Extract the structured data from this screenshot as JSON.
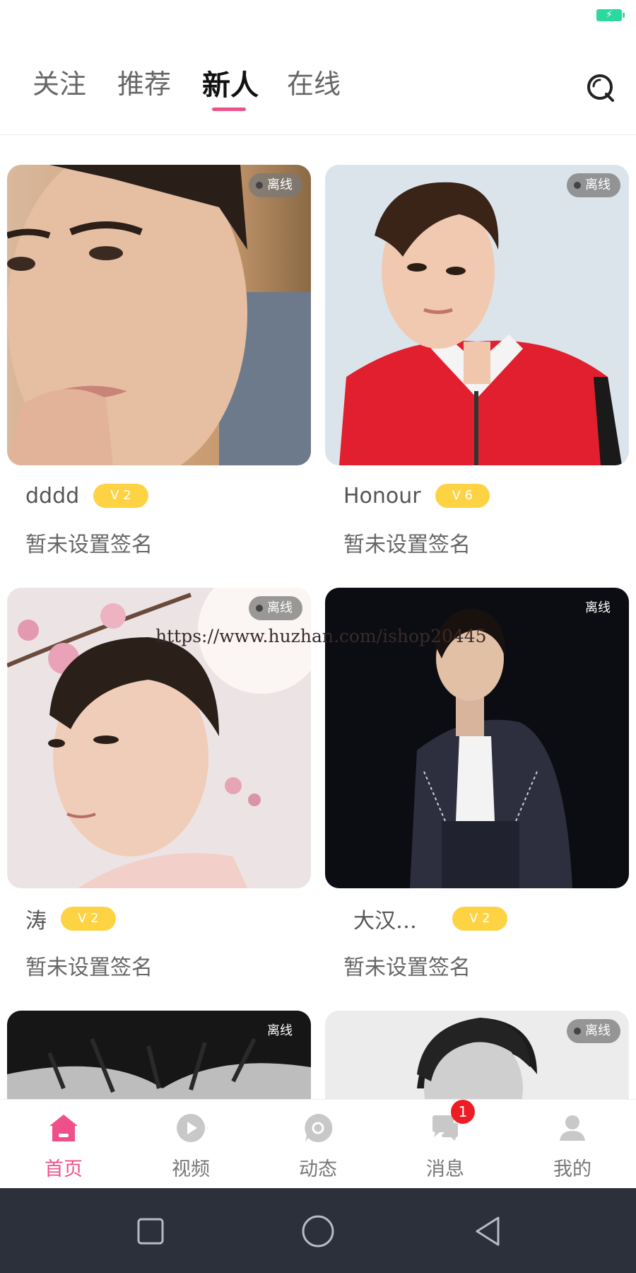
{
  "status_bar": {
    "battery_icon": "charging-battery-icon",
    "battery_color": "#2bd9a0"
  },
  "top_tabs": {
    "tabs": [
      {
        "label": "关注"
      },
      {
        "label": "推荐"
      },
      {
        "label": "新人",
        "active": true
      },
      {
        "label": "在线"
      }
    ],
    "accent_color": "#f0508a",
    "search_icon": "search-icon"
  },
  "users": [
    {
      "name": "dddd",
      "level": "V 2",
      "status": "离线",
      "signature": "暂未设置签名"
    },
    {
      "name": "Honour",
      "level": "V 6",
      "status": "离线",
      "signature": "暂未设置签名"
    },
    {
      "name": "涛",
      "level": "V 2",
      "status": "离线",
      "signature": "暂未设置签名"
    },
    {
      "name": "大汉…",
      "level": "V 2",
      "status": "离线",
      "signature": "暂未设置签名"
    },
    {
      "name": "",
      "level": "",
      "status": "离线",
      "signature": ""
    },
    {
      "name": "",
      "level": "",
      "status": "离线",
      "signature": ""
    }
  ],
  "watermark": "https://www.huzhan.com/ishop20445",
  "bottom_nav": {
    "items": [
      {
        "label": "首页",
        "icon": "home-icon",
        "active": true
      },
      {
        "label": "视频",
        "icon": "play-icon"
      },
      {
        "label": "动态",
        "icon": "moments-icon"
      },
      {
        "label": "消息",
        "icon": "chat-icon",
        "badge": "1"
      },
      {
        "label": "我的",
        "icon": "profile-icon"
      }
    ],
    "active_color": "#f0508a",
    "badge_color": "#ee1c25"
  },
  "system_nav": {
    "buttons": [
      "recents-icon",
      "home-circle-icon",
      "back-icon"
    ]
  },
  "colors": {
    "level_badge": "#fdd344",
    "system_bar": "#2c303a"
  }
}
